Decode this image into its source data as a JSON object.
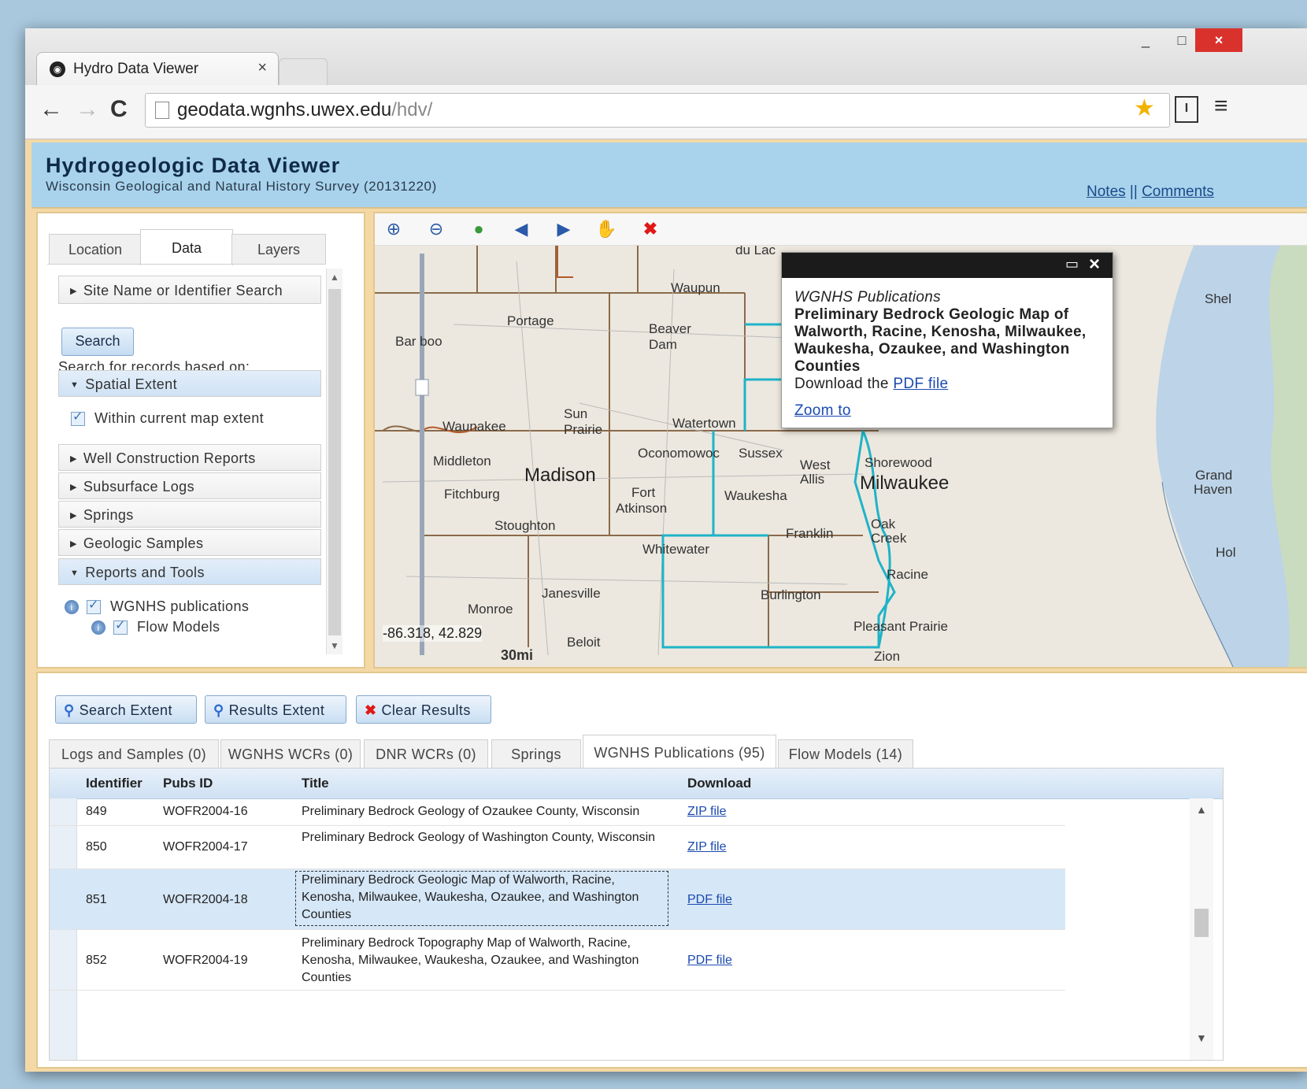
{
  "browser": {
    "tab_title": "Hydro Data Viewer",
    "tab_close": "×",
    "url_host": "geodata.wgnhs.uwex.edu",
    "url_path": "/hdv/",
    "back": "←",
    "forward": "→",
    "reload": "C",
    "window_min": "_",
    "window_max": "□",
    "window_close": "×",
    "star": "★",
    "menu": "≡"
  },
  "header": {
    "title": "Hydrogeologic Data Viewer",
    "subtitle": "Wisconsin Geological and Natural History Survey (20131220)",
    "notes": "Notes",
    "separator": " || ",
    "comments": "Comments"
  },
  "left_panel": {
    "tabs": [
      "Location",
      "Data",
      "Layers"
    ],
    "active_tab": "Data",
    "site_search": "Site Name or Identifier Search",
    "search_button": "Search",
    "based_on": "Search for records based on:",
    "spatial_extent": "Spatial Extent",
    "within_extent": "Within current map extent",
    "sections": [
      "Well Construction Reports",
      "Subsurface Logs",
      "Springs",
      "Geologic Samples"
    ],
    "reports_tools": "Reports and Tools",
    "wgnhs_pubs": "WGNHS publications",
    "flow_models": "Flow Models"
  },
  "map": {
    "tools": [
      "zoom-in",
      "zoom-out",
      "full-extent",
      "previous-extent",
      "next-extent",
      "pan",
      "clear"
    ],
    "coords": "-86.318, 42.829",
    "scale": "30mi",
    "places": {
      "waupun": "Waupun",
      "portage": "Portage",
      "baraboo": "Bar boo",
      "beaver": "Beaver",
      "dam": "Dam",
      "shel": "Shel",
      "waunakee": "Waunakee",
      "sun": "Sun",
      "prairie": "Prairie",
      "watertown": "Watertown",
      "middleton": "Middleton",
      "madison": "Madison",
      "oconomowoc": "Oconomowoc",
      "sussex": "Sussex",
      "westallis": "West Allis",
      "shorewood": "Shorewood",
      "milwaukee": "Milwaukee",
      "grand": "Grand",
      "haven": "Haven",
      "fitchburg": "Fitchburg",
      "fort": "Fort",
      "atkinson": "Atkinson",
      "waukesha": "Waukesha",
      "stoughton": "Stoughton",
      "oak": "Oak",
      "creek": "Creek",
      "franklin": "Franklin",
      "whitewater": "Whitewater",
      "hol": "Hol",
      "racine": "Racine",
      "janesville": "Janesville",
      "burlington": "Burlington",
      "monroe": "Monroe",
      "pleasant": "Pleasant Prairie",
      "beloit": "Beloit",
      "zion": "Zion",
      "fonddulac": "du Lac"
    },
    "popup": {
      "category": "WGNHS Publications",
      "title": "Preliminary Bedrock Geologic Map of Walworth, Racine, Kenosha, Milwaukee, Waukesha, Ozaukee, and Washington Counties",
      "download_prefix": "Download the ",
      "download_link": "PDF file",
      "zoom": "Zoom to"
    }
  },
  "results": {
    "buttons": {
      "search_extent": "Search Extent",
      "results_extent": "Results Extent",
      "clear_results": "Clear Results"
    },
    "tabs": [
      "Logs and Samples (0)",
      "WGNHS WCRs (0)",
      "DNR WCRs (0)",
      "Springs",
      "WGNHS Publications (95)",
      "Flow Models (14)"
    ],
    "active_tab": "WGNHS Publications (95)",
    "columns": [
      "Identifier",
      "Pubs ID",
      "Title",
      "Download"
    ],
    "rows": [
      {
        "id": "849",
        "pubs_id": "WOFR2004-16",
        "title": "Preliminary Bedrock Geology of Ozaukee County, Wisconsin",
        "download": "ZIP file"
      },
      {
        "id": "850",
        "pubs_id": "WOFR2004-17",
        "title": "Preliminary Bedrock Geology of Washington County, Wisconsin",
        "download": "ZIP file"
      },
      {
        "id": "851",
        "pubs_id": "WOFR2004-18",
        "title": "Preliminary Bedrock Geologic Map of Walworth, Racine, Kenosha, Milwaukee, Waukesha, Ozaukee, and Washington Counties",
        "download": "PDF file"
      },
      {
        "id": "852",
        "pubs_id": "WOFR2004-19",
        "title": "Preliminary Bedrock Topography Map of Walworth, Racine, Kenosha, Milwaukee, Waukesha, Ozaukee, and Washington Counties",
        "download": "PDF file"
      }
    ]
  },
  "colors": {
    "header_bg": "#a9d3ec",
    "frame": "#f4d9a6",
    "county_highlight": "#1fb3c8",
    "link": "#1a4ab0"
  }
}
